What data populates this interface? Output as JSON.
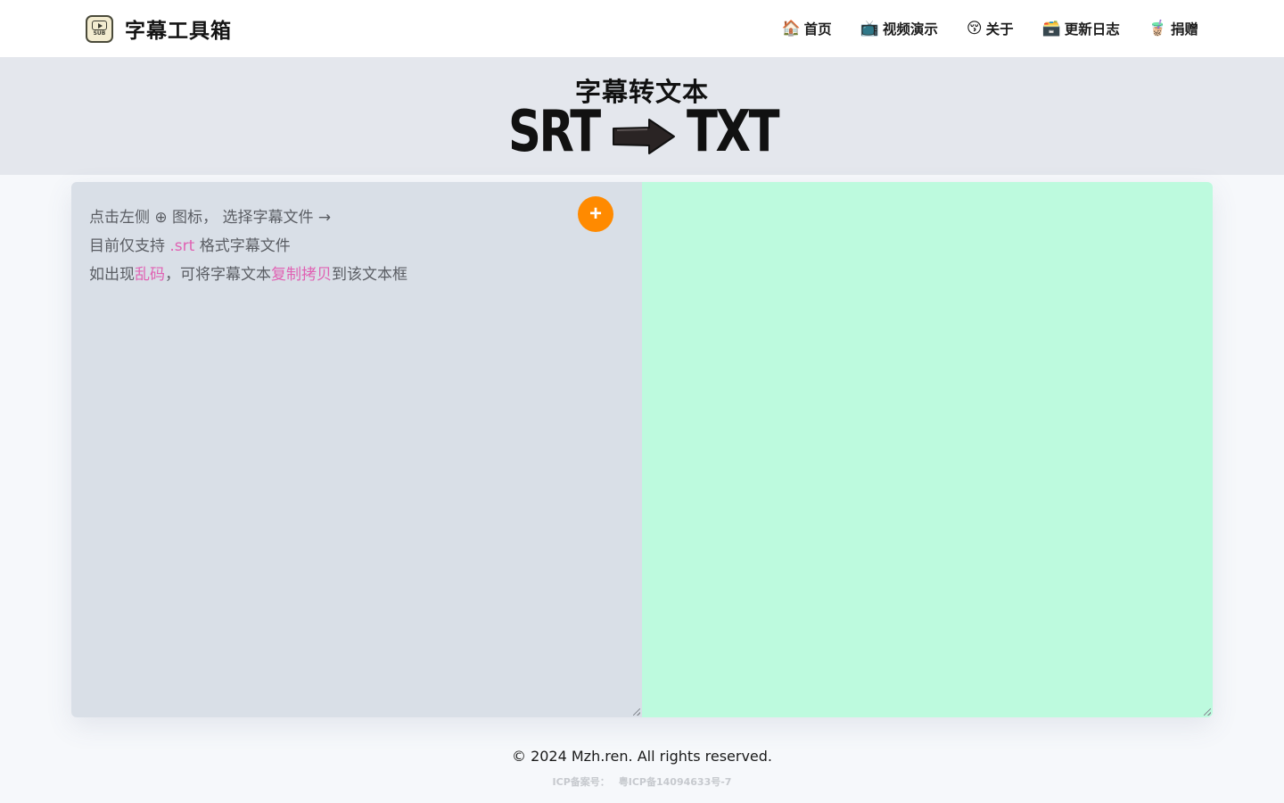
{
  "header": {
    "logo_text": "SUB",
    "site_title": "字幕工具箱",
    "nav": [
      {
        "icon": "🏠",
        "icon_name": "house-icon",
        "label": "首页"
      },
      {
        "icon": "📺",
        "icon_name": "tv-icon",
        "label": "视频演示"
      },
      {
        "icon": "😚",
        "icon_name": "smiley-icon",
        "label": "关于"
      },
      {
        "icon": "🗃️",
        "icon_name": "card-box-icon",
        "label": "更新日志"
      },
      {
        "icon": "🧋",
        "icon_name": "bubble-tea-icon",
        "label": "捐赠"
      }
    ]
  },
  "hero": {
    "title": "字幕转文本",
    "from_format": "SRT",
    "to_format": "TXT"
  },
  "converter": {
    "instructions": {
      "line1": "点击左侧 ⊕ 图标， 选择字幕文件 →",
      "line2_prefix": "目前仅支持 ",
      "line2_highlight": ".srt",
      "line2_suffix": " 格式字幕文件",
      "line3_prefix": "如出现",
      "line3_highlight1": "乱码",
      "line3_middle": "，可将字幕文本",
      "line3_highlight2": "复制拷贝",
      "line3_suffix": "到该文本框"
    },
    "add_button_label": "+",
    "output_value": ""
  },
  "footer": {
    "copyright": "© 2024 Mzh.ren. All rights reserved.",
    "icp_label": "ICP备案号：",
    "icp_number": "粤ICP备14094633号-7"
  },
  "colors": {
    "accent_orange": "#ff8a00",
    "highlight_pink": "#e062b3",
    "left_panel": "#d9dfe7",
    "right_panel": "#bdfade",
    "hero_bg": "#e4e7ed"
  }
}
